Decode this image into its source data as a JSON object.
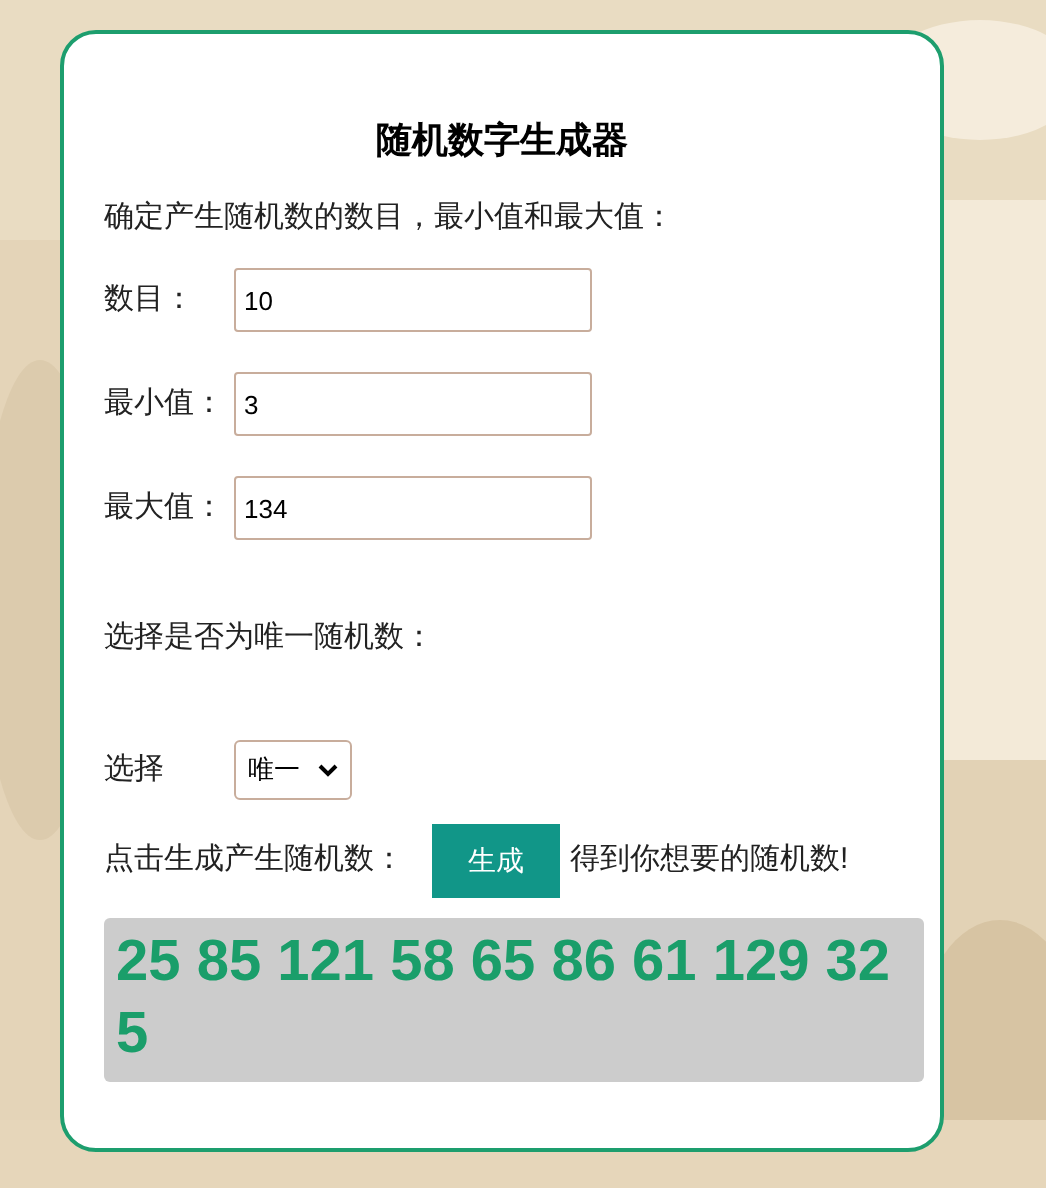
{
  "title": "随机数字生成器",
  "instruction": "确定产生随机数的数目，最小值和最大值：",
  "fields": [
    {
      "label": "数目：",
      "value": "10"
    },
    {
      "label": "最小值：",
      "value": "3"
    },
    {
      "label": "最大值：",
      "value": "134"
    }
  ],
  "unique_prompt": "选择是否为唯一随机数：",
  "select": {
    "label": "选择",
    "value": "唯一"
  },
  "generate": {
    "before": "点击生成产生随机数：",
    "button": "生成",
    "after": "得到你想要的随机数!"
  },
  "result": "25 85 121 58 65 86 61 129 32 5"
}
